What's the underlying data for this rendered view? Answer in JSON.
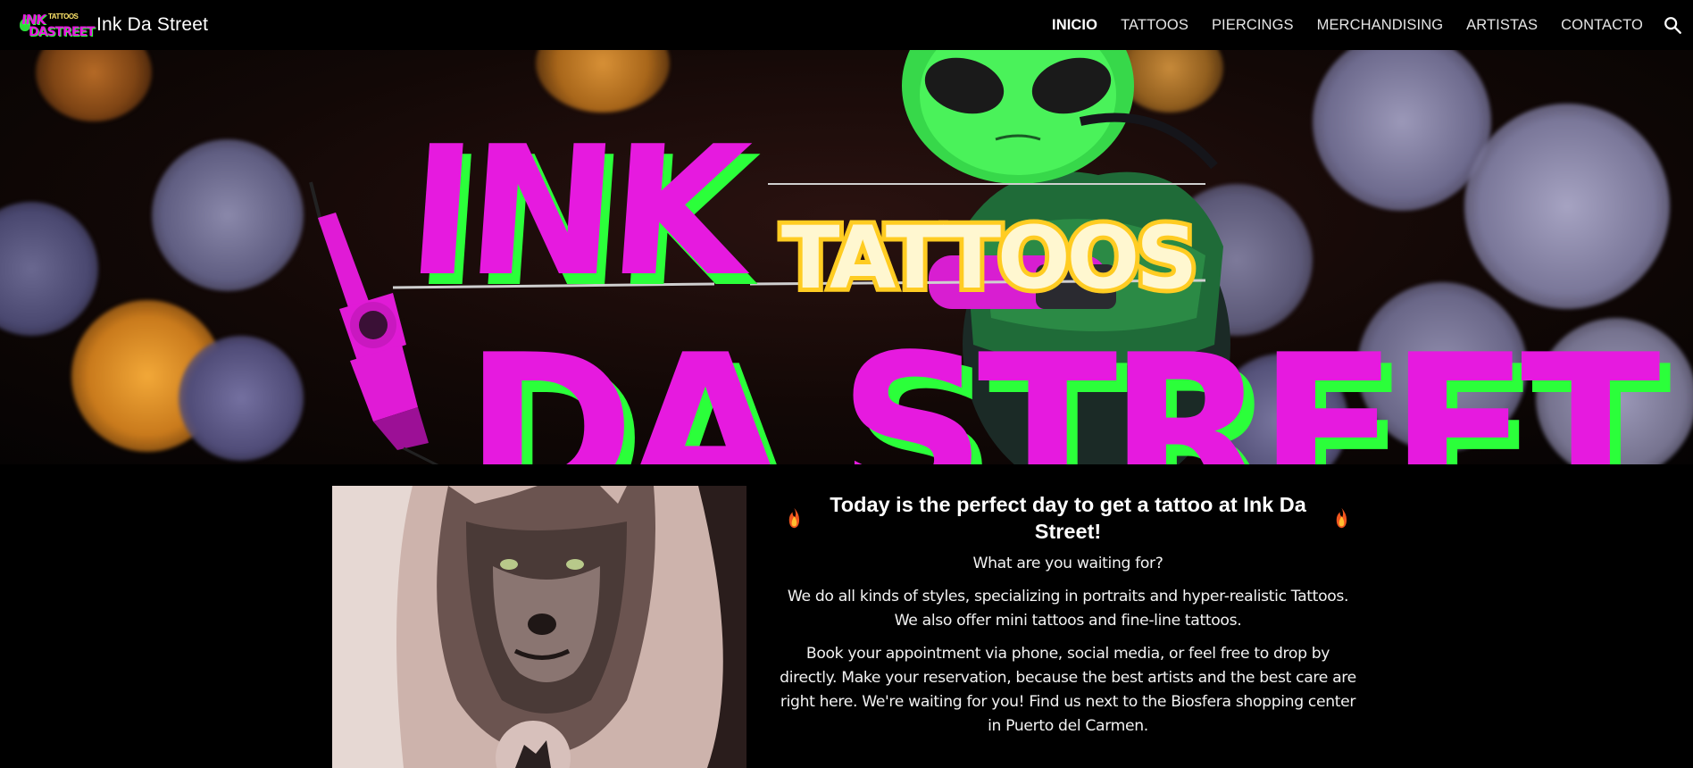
{
  "header": {
    "site_title": "Ink Da Street",
    "logo_ink": "INK",
    "logo_tattoos": "TATTOOS",
    "logo_street": "DASTREET"
  },
  "nav": {
    "items": [
      "INICIO",
      "TATTOOS",
      "PIERCINGS",
      "MERCHANDISING",
      "ARTISTAS",
      "CONTACTO"
    ],
    "active": "INICIO"
  },
  "hero": {
    "word_ink": "INK",
    "word_tattoos": "TATTOOS",
    "word_street": "DA STREET"
  },
  "main": {
    "headline": "Today is the perfect day to get a tattoo at Ink Da Street!",
    "question": "What are you waiting for?",
    "paragraph_1": "We do all kinds of styles, specializing in portraits and hyper-realistic Tattoos. We also offer mini tattoos and fine-line tattoos.",
    "paragraph_2": "Book your appointment via phone, social media, or feel free to drop by directly. Make your reservation, because the best artists and the best care are right here. We're waiting for you! Find us next to the Biosfera shopping center in Puerto del Carmen."
  },
  "colors": {
    "accent_magenta": "#e61adf",
    "accent_green": "#2bff3a",
    "accent_yellow": "#ffe66a",
    "background": "#000000"
  }
}
